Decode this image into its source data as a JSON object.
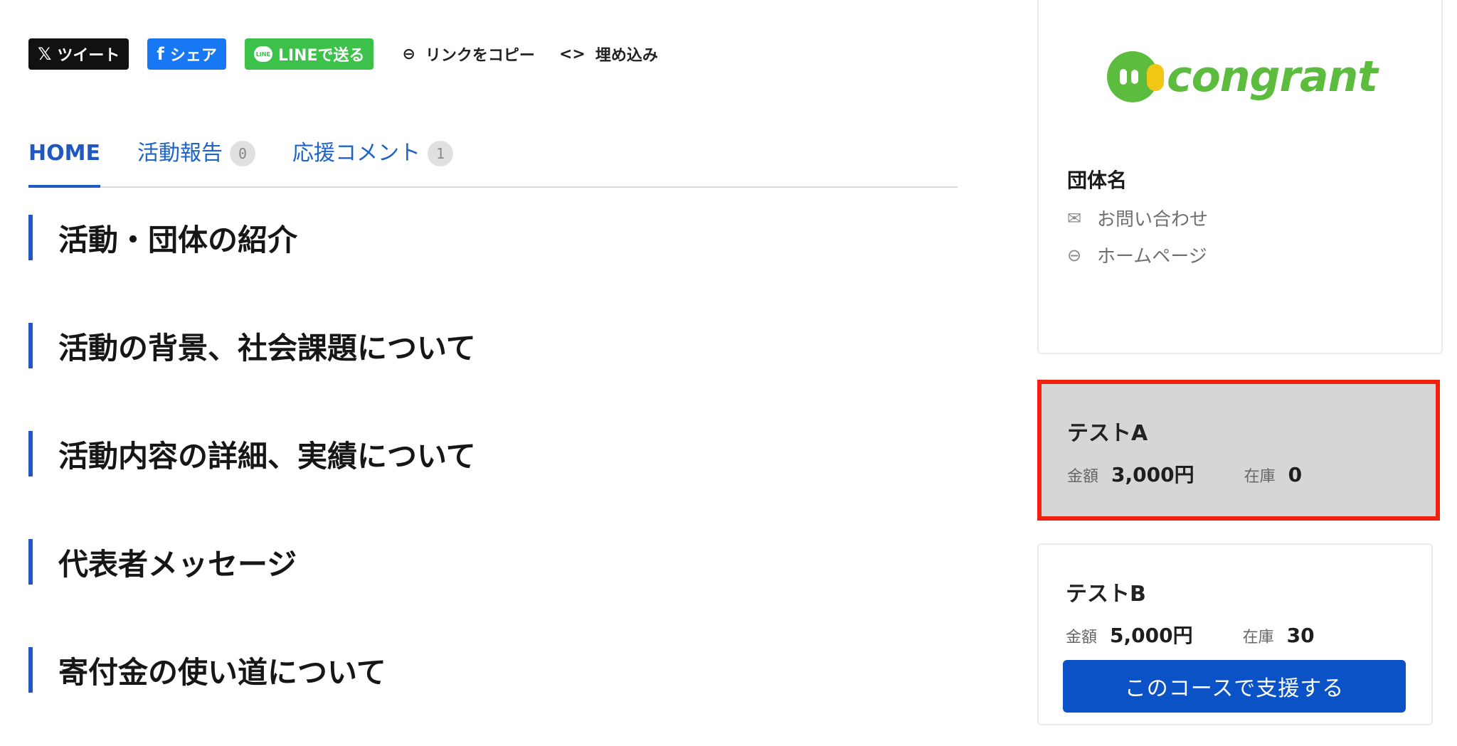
{
  "share": {
    "tweet": "ツイート",
    "facebook": "シェア",
    "line_badge": "LINE",
    "line": "LINEで送る",
    "copy_link": "リンクをコピー",
    "embed": "埋め込み"
  },
  "tabs": [
    {
      "label": "HOME",
      "count": null
    },
    {
      "label": "活動報告",
      "count": "0"
    },
    {
      "label": "応援コメント",
      "count": "1"
    }
  ],
  "sections": [
    "活動・団体の紹介",
    "活動の背景、社会課題について",
    "活動内容の詳細、実績について",
    "代表者メッセージ",
    "寄付金の使い道について"
  ],
  "org": {
    "logo_text": "congrant",
    "name": "団体名",
    "contact": "お問い合わせ",
    "homepage": "ホームページ"
  },
  "courses": [
    {
      "name": "テストA",
      "amount_label": "金額",
      "amount": "3,000円",
      "stock_label": "在庫",
      "stock": "0"
    },
    {
      "name": "テストB",
      "amount_label": "金額",
      "amount": "5,000円",
      "stock_label": "在庫",
      "stock": "30",
      "button": "このコースで支援する"
    }
  ],
  "colors": {
    "accent": "#1f58c0",
    "logo_green": "#5cbc3d",
    "logo_yellow": "#f2c615",
    "highlight_border": "#f0210e",
    "button_blue": "#0a52c6"
  },
  "icons": [
    "x-logo-icon",
    "facebook-icon",
    "line-icon",
    "link-icon",
    "code-icon",
    "mail-icon"
  ]
}
